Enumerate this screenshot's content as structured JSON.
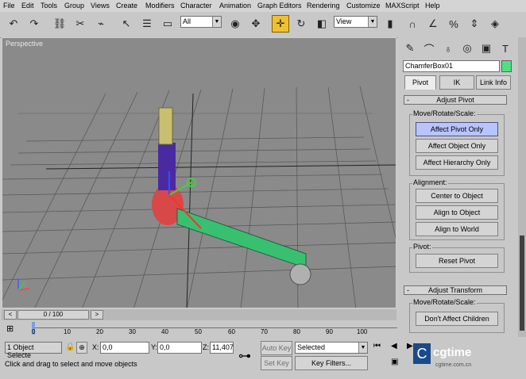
{
  "menu": [
    "File",
    "Edit",
    "Tools",
    "Group",
    "Views",
    "Create",
    "Modifiers",
    "Character",
    "Animation",
    "Graph Editors",
    "Rendering",
    "Customize",
    "MAXScript",
    "Help"
  ],
  "toolbar": {
    "selection_filter": "All",
    "reference_coord": "View"
  },
  "viewport": {
    "label": "Perspective"
  },
  "command_panel": {
    "object_name": "ChamferBox01",
    "object_color": "#50e080",
    "tabs": [
      "Pivot",
      "IK",
      "Link Info"
    ],
    "active_tab": "Pivot",
    "adjust_pivot": {
      "title": "Adjust Pivot",
      "move_rotate_scale_label": "Move/Rotate/Scale:",
      "affect_pivot_only": "Affect Pivot Only",
      "affect_object_only": "Affect Object Only",
      "affect_hierarchy_only": "Affect Hierarchy Only",
      "alignment_label": "Alignment:",
      "center_to_object": "Center to Object",
      "align_to_object": "Align to Object",
      "align_to_world": "Align to World",
      "pivot_label": "Pivot:",
      "reset_pivot": "Reset Pivot"
    },
    "adjust_transform": {
      "title": "Adjust Transform",
      "move_rotate_scale_label": "Move/Rotate/Scale:",
      "dont_affect_children": "Don't Affect Children"
    }
  },
  "timeline": {
    "frame_display": "0 / 100",
    "ticks": [
      "0",
      "10",
      "20",
      "30",
      "40",
      "50",
      "60",
      "70",
      "80",
      "90",
      "100"
    ]
  },
  "status": {
    "selection_count": "1 Object Selecte",
    "x_label": "X:",
    "x_value": "0,0",
    "y_label": "Y:",
    "y_value": "0,0",
    "z_label": "Z:",
    "z_value": "11,407",
    "auto_key": "Auto Key",
    "set_key": "Set Key",
    "key_mode": "Selected",
    "key_filters": "Key Filters...",
    "prompt": "Click and drag to select and move objects"
  },
  "watermark": "cgtime.com.cn"
}
